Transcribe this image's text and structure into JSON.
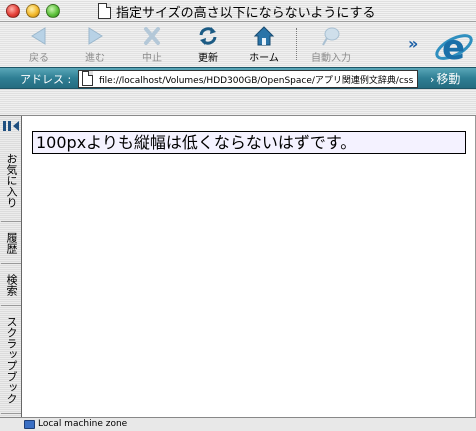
{
  "window": {
    "title": "指定サイズの高さ以下にならないようにする"
  },
  "toolbar": {
    "back_label": "戻る",
    "forward_label": "進む",
    "stop_label": "中止",
    "refresh_label": "更新",
    "home_label": "ホーム",
    "autofill_label": "自動入力",
    "more_label": "»",
    "logo_icon": "ie-logo-icon"
  },
  "address_bar": {
    "label": "アドレス :",
    "url": "file://localhost/Volumes/HDD300GB/OpenSpace/アプリ関連例文辞典/css",
    "go_label": "移動"
  },
  "sidebar": {
    "tabs": [
      "お気に入り",
      "履歴",
      "検索",
      "スクラップブック"
    ]
  },
  "content": {
    "text": "100pxよりも縦幅は低くならないはずです。"
  },
  "status": {
    "zone": "Local machine zone"
  },
  "colors": {
    "address_bar": "#2f7f94",
    "accent_blue": "#1b5fa6",
    "box_background": "#f4f2ff"
  }
}
